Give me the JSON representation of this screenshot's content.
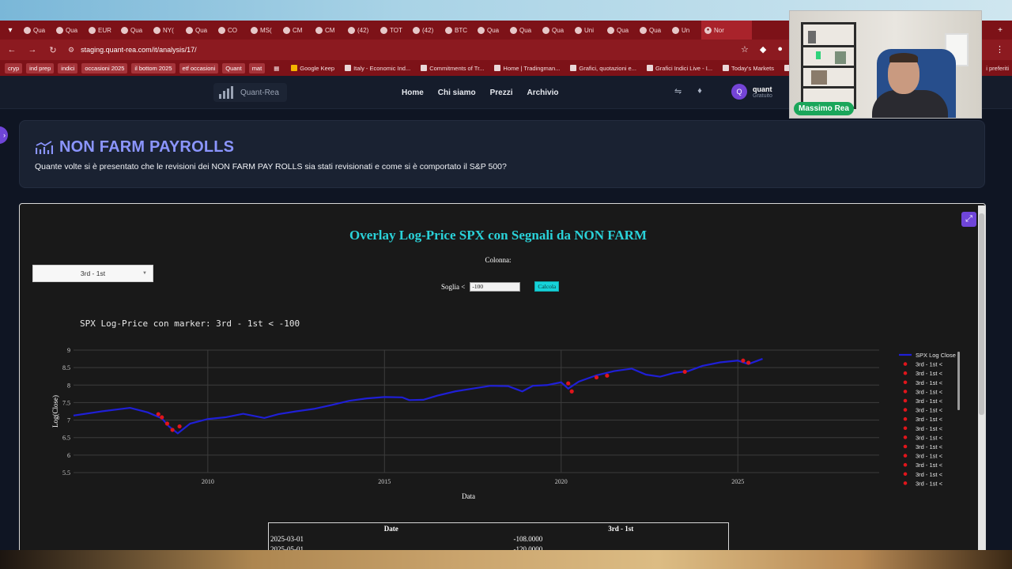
{
  "browser": {
    "tabs": [
      {
        "label": "Qua"
      },
      {
        "label": "Qua"
      },
      {
        "label": "EUR"
      },
      {
        "label": "Qua"
      },
      {
        "label": "NY("
      },
      {
        "label": "Qua"
      },
      {
        "label": "CO"
      },
      {
        "label": "MS("
      },
      {
        "label": "CM"
      },
      {
        "label": "CM"
      },
      {
        "label": "(42)"
      },
      {
        "label": "TOT"
      },
      {
        "label": "(42)"
      },
      {
        "label": "BTC"
      },
      {
        "label": "Qua"
      },
      {
        "label": "Qua"
      },
      {
        "label": "Qua"
      },
      {
        "label": "Uni"
      },
      {
        "label": "Qua"
      },
      {
        "label": "Qua"
      },
      {
        "label": "Un"
      }
    ],
    "active_tab": {
      "label": "Nor"
    },
    "url": "staging.quant-rea.com/it/analysis/17/",
    "bookmarks": [
      {
        "label": "cryp",
        "kind": "chip"
      },
      {
        "label": "ind prep",
        "kind": "chip"
      },
      {
        "label": "indici",
        "kind": "chip"
      },
      {
        "label": "occasioni 2025",
        "kind": "chip"
      },
      {
        "label": "il bottom 2025",
        "kind": "chip"
      },
      {
        "label": "etf occasioni",
        "kind": "chip"
      },
      {
        "label": "Quant",
        "kind": "chip"
      },
      {
        "label": "mat",
        "kind": "chip"
      },
      {
        "label": "Google Keep",
        "kind": "link"
      },
      {
        "label": "Italy - Economic Ind...",
        "kind": "link"
      },
      {
        "label": "Commitments of Tr...",
        "kind": "link"
      },
      {
        "label": "Home | Tradingman...",
        "kind": "link"
      },
      {
        "label": "Grafici, quotazioni e...",
        "kind": "link"
      },
      {
        "label": "Grafici Indici Live - I...",
        "kind": "link"
      },
      {
        "label": "Today's Markets",
        "kind": "link"
      },
      {
        "label": "F",
        "kind": "link"
      }
    ],
    "bookmarks_end": "i preferiti"
  },
  "site": {
    "logo_text": "Quant-Rea",
    "menu": [
      "Home",
      "Chi siamo",
      "Prezzi",
      "Archivio"
    ],
    "user": {
      "initial": "Q",
      "name": "quant",
      "plan": "Gratuito"
    }
  },
  "header": {
    "title": "NON FARM PAYROLLS",
    "subtitle": "Quante volte si è presentato che le revisioni dei NON FARM PAY ROLLS sia stati revisionati e come si è comportato il S&P 500?"
  },
  "panel": {
    "title": "Overlay Log-Price SPX con Segnali da NON FARM",
    "column_label": "Colonna:",
    "dropdown_value": "3rd - 1st",
    "threshold_label": "Soglia <",
    "threshold_value": "-100",
    "calc_label": "Calcola"
  },
  "chart_data": {
    "type": "scatter",
    "title": "SPX Log-Price con marker: 3rd - 1st < -100",
    "xlabel": "Data",
    "ylabel": "Log(Close)",
    "xlim": [
      2006.2,
      2029.0
    ],
    "ylim": [
      5.5,
      9.0
    ],
    "xticks": [
      {
        "v": 2010,
        "label": "2010"
      },
      {
        "v": 2015,
        "label": "2015"
      },
      {
        "v": 2020,
        "label": "2020"
      },
      {
        "v": 2025,
        "label": "2025"
      }
    ],
    "yticks": [
      {
        "v": 5.5,
        "label": "5.5"
      },
      {
        "v": 6,
        "label": "6"
      },
      {
        "v": 6.5,
        "label": "6.5"
      },
      {
        "v": 7,
        "label": "7"
      },
      {
        "v": 7.5,
        "label": "7.5"
      },
      {
        "v": 8,
        "label": "8"
      },
      {
        "v": 8.5,
        "label": "8.5"
      },
      {
        "v": 9,
        "label": "9"
      }
    ],
    "grid": true,
    "legend_position": "right",
    "series": [
      {
        "name": "SPX Log Close",
        "mode": "line",
        "color": "#1f1fd6",
        "x": [
          2006.2,
          2007.0,
          2007.8,
          2008.3,
          2008.7,
          2008.9,
          2009.15,
          2009.5,
          2010.0,
          2010.5,
          2011.0,
          2011.6,
          2012.0,
          2012.5,
          2013.0,
          2013.5,
          2014.0,
          2014.5,
          2015.0,
          2015.5,
          2015.7,
          2016.1,
          2016.5,
          2017.0,
          2017.5,
          2018.0,
          2018.5,
          2018.9,
          2019.2,
          2019.6,
          2020.0,
          2020.2,
          2020.5,
          2021.0,
          2021.5,
          2022.0,
          2022.4,
          2022.8,
          2023.2,
          2023.6,
          2024.0,
          2024.5,
          2025.0,
          2025.3,
          2025.7
        ],
        "y": [
          7.13,
          7.25,
          7.35,
          7.22,
          7.05,
          6.82,
          6.62,
          6.9,
          7.03,
          7.08,
          7.18,
          7.06,
          7.17,
          7.25,
          7.32,
          7.43,
          7.55,
          7.62,
          7.66,
          7.65,
          7.57,
          7.58,
          7.7,
          7.82,
          7.9,
          7.98,
          7.97,
          7.82,
          7.98,
          8.0,
          8.08,
          7.9,
          8.1,
          8.28,
          8.4,
          8.47,
          8.3,
          8.24,
          8.35,
          8.4,
          8.55,
          8.65,
          8.7,
          8.6,
          8.75
        ]
      },
      {
        "name": "3rd - 1st <",
        "mode": "markers",
        "color": "#e0151b",
        "x": [
          2008.6,
          2008.7,
          2008.85,
          2009.0,
          2009.2,
          2020.2,
          2020.3,
          2021.0,
          2021.3,
          2023.5,
          2025.15,
          2025.3
        ],
        "y": [
          7.17,
          7.08,
          6.9,
          6.72,
          6.82,
          8.05,
          7.82,
          8.22,
          8.27,
          8.38,
          8.7,
          8.64
        ]
      }
    ],
    "legend_entries": [
      "SPX Log Close",
      "3rd - 1st <",
      "3rd - 1st <",
      "3rd - 1st <",
      "3rd - 1st <",
      "3rd - 1st <",
      "3rd - 1st <",
      "3rd - 1st <",
      "3rd - 1st <",
      "3rd - 1st <",
      "3rd - 1st <",
      "3rd - 1st <",
      "3rd - 1st <",
      "3rd - 1st <",
      "3rd - 1st <"
    ]
  },
  "table": {
    "headers": [
      "Date",
      "3rd - 1st"
    ],
    "rows": [
      [
        "2025-03-01",
        "-108.0000"
      ],
      [
        "2025-05-01",
        "-120.0000"
      ]
    ]
  },
  "webcam": {
    "name": "Massimo Rea"
  }
}
